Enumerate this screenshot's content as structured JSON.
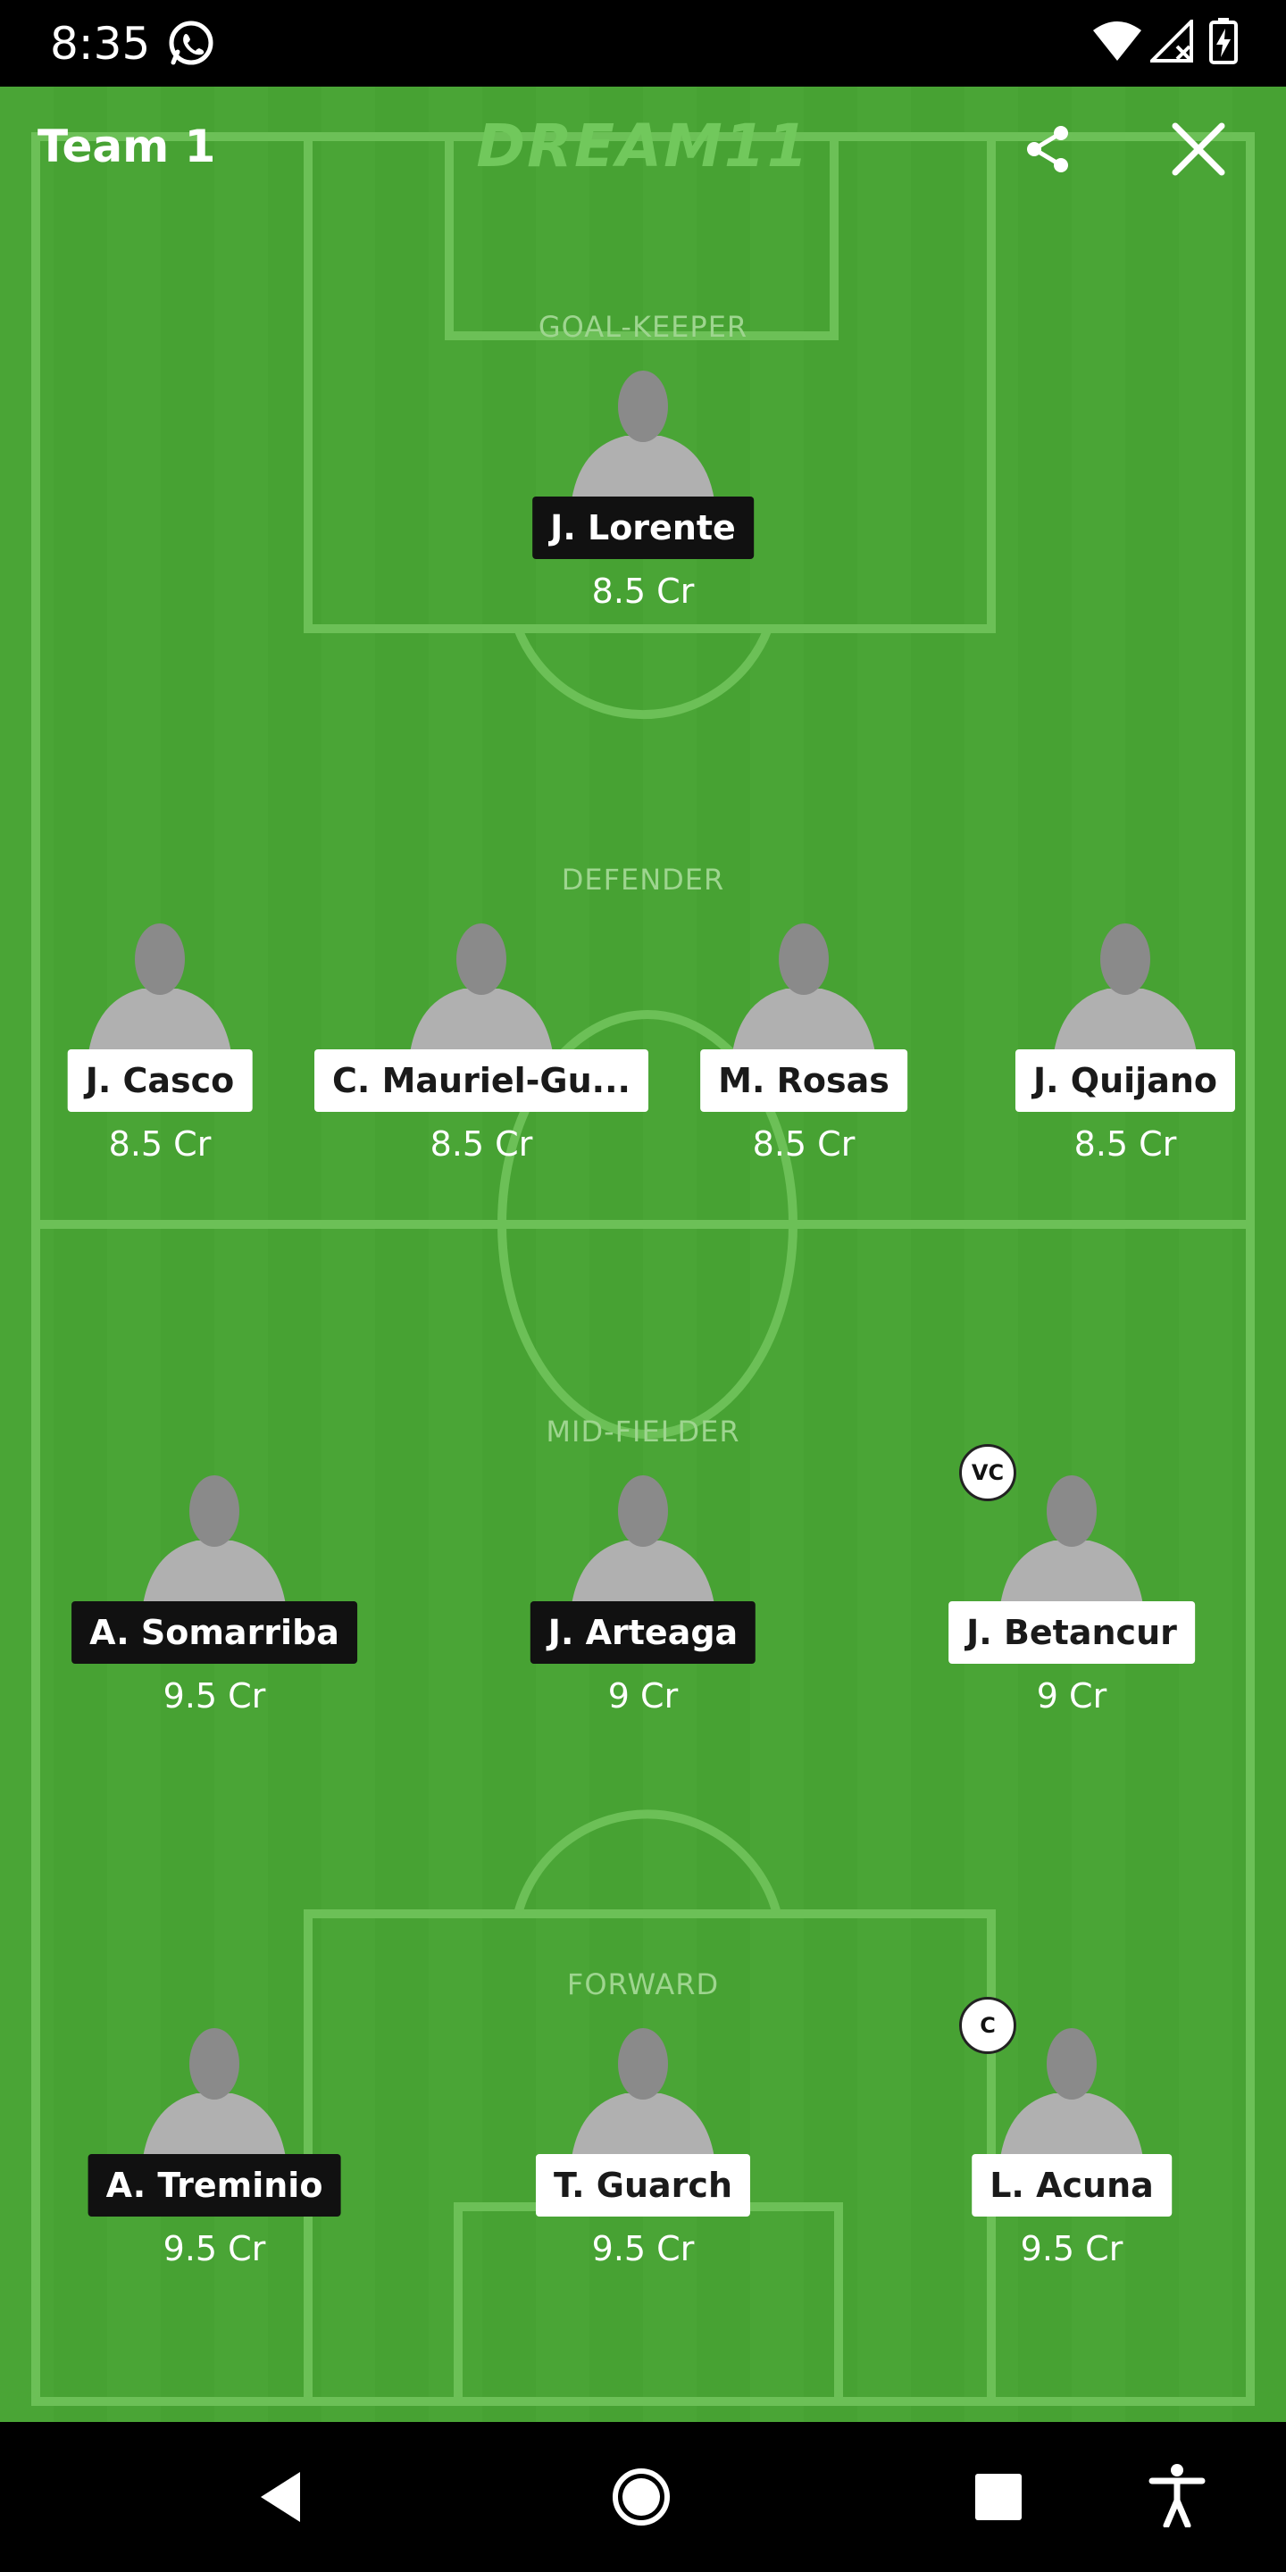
{
  "status_bar": {
    "time": "8:35"
  },
  "header": {
    "team_title": "Team 1",
    "brand": "DREAM11"
  },
  "sections": {
    "goalkeeper": "GOAL-KEEPER",
    "defender": "DEFENDER",
    "midfielder": "MID-FIELDER",
    "forward": "FORWARD"
  },
  "players": {
    "gk": [
      {
        "name": "J. Lorente",
        "credits": "8.5 Cr",
        "tag_style": "black"
      }
    ],
    "def": [
      {
        "name": "J. Casco",
        "credits": "8.5 Cr",
        "tag_style": "white"
      },
      {
        "name": "C. Mauriel-Gu...",
        "credits": "8.5 Cr",
        "tag_style": "white"
      },
      {
        "name": "M. Rosas",
        "credits": "8.5 Cr",
        "tag_style": "white"
      },
      {
        "name": "J. Quijano",
        "credits": "8.5 Cr",
        "tag_style": "white"
      }
    ],
    "mid": [
      {
        "name": "A. Somarriba",
        "credits": "9.5 Cr",
        "tag_style": "black"
      },
      {
        "name": "J. Arteaga",
        "credits": "9 Cr",
        "tag_style": "black"
      },
      {
        "name": "J. Betancur",
        "credits": "9 Cr",
        "tag_style": "white",
        "badge": "VC"
      }
    ],
    "fwd": [
      {
        "name": "A. Treminio",
        "credits": "9.5 Cr",
        "tag_style": "black"
      },
      {
        "name": "T. Guarch",
        "credits": "9.5 Cr",
        "tag_style": "white"
      },
      {
        "name": "L. Acuna",
        "credits": "9.5 Cr",
        "tag_style": "white",
        "badge": "C"
      }
    ]
  },
  "colors": {
    "pitch": "#4aa536",
    "pitch_stripe": "#47a233",
    "lines": "#6cc057",
    "section_label": "#9ed58f"
  },
  "icons": {
    "share": "share-icon",
    "close": "close-icon",
    "back": "back-triangle-icon",
    "home": "home-circle-icon",
    "recents": "recents-square-icon",
    "accessibility": "accessibility-icon"
  }
}
